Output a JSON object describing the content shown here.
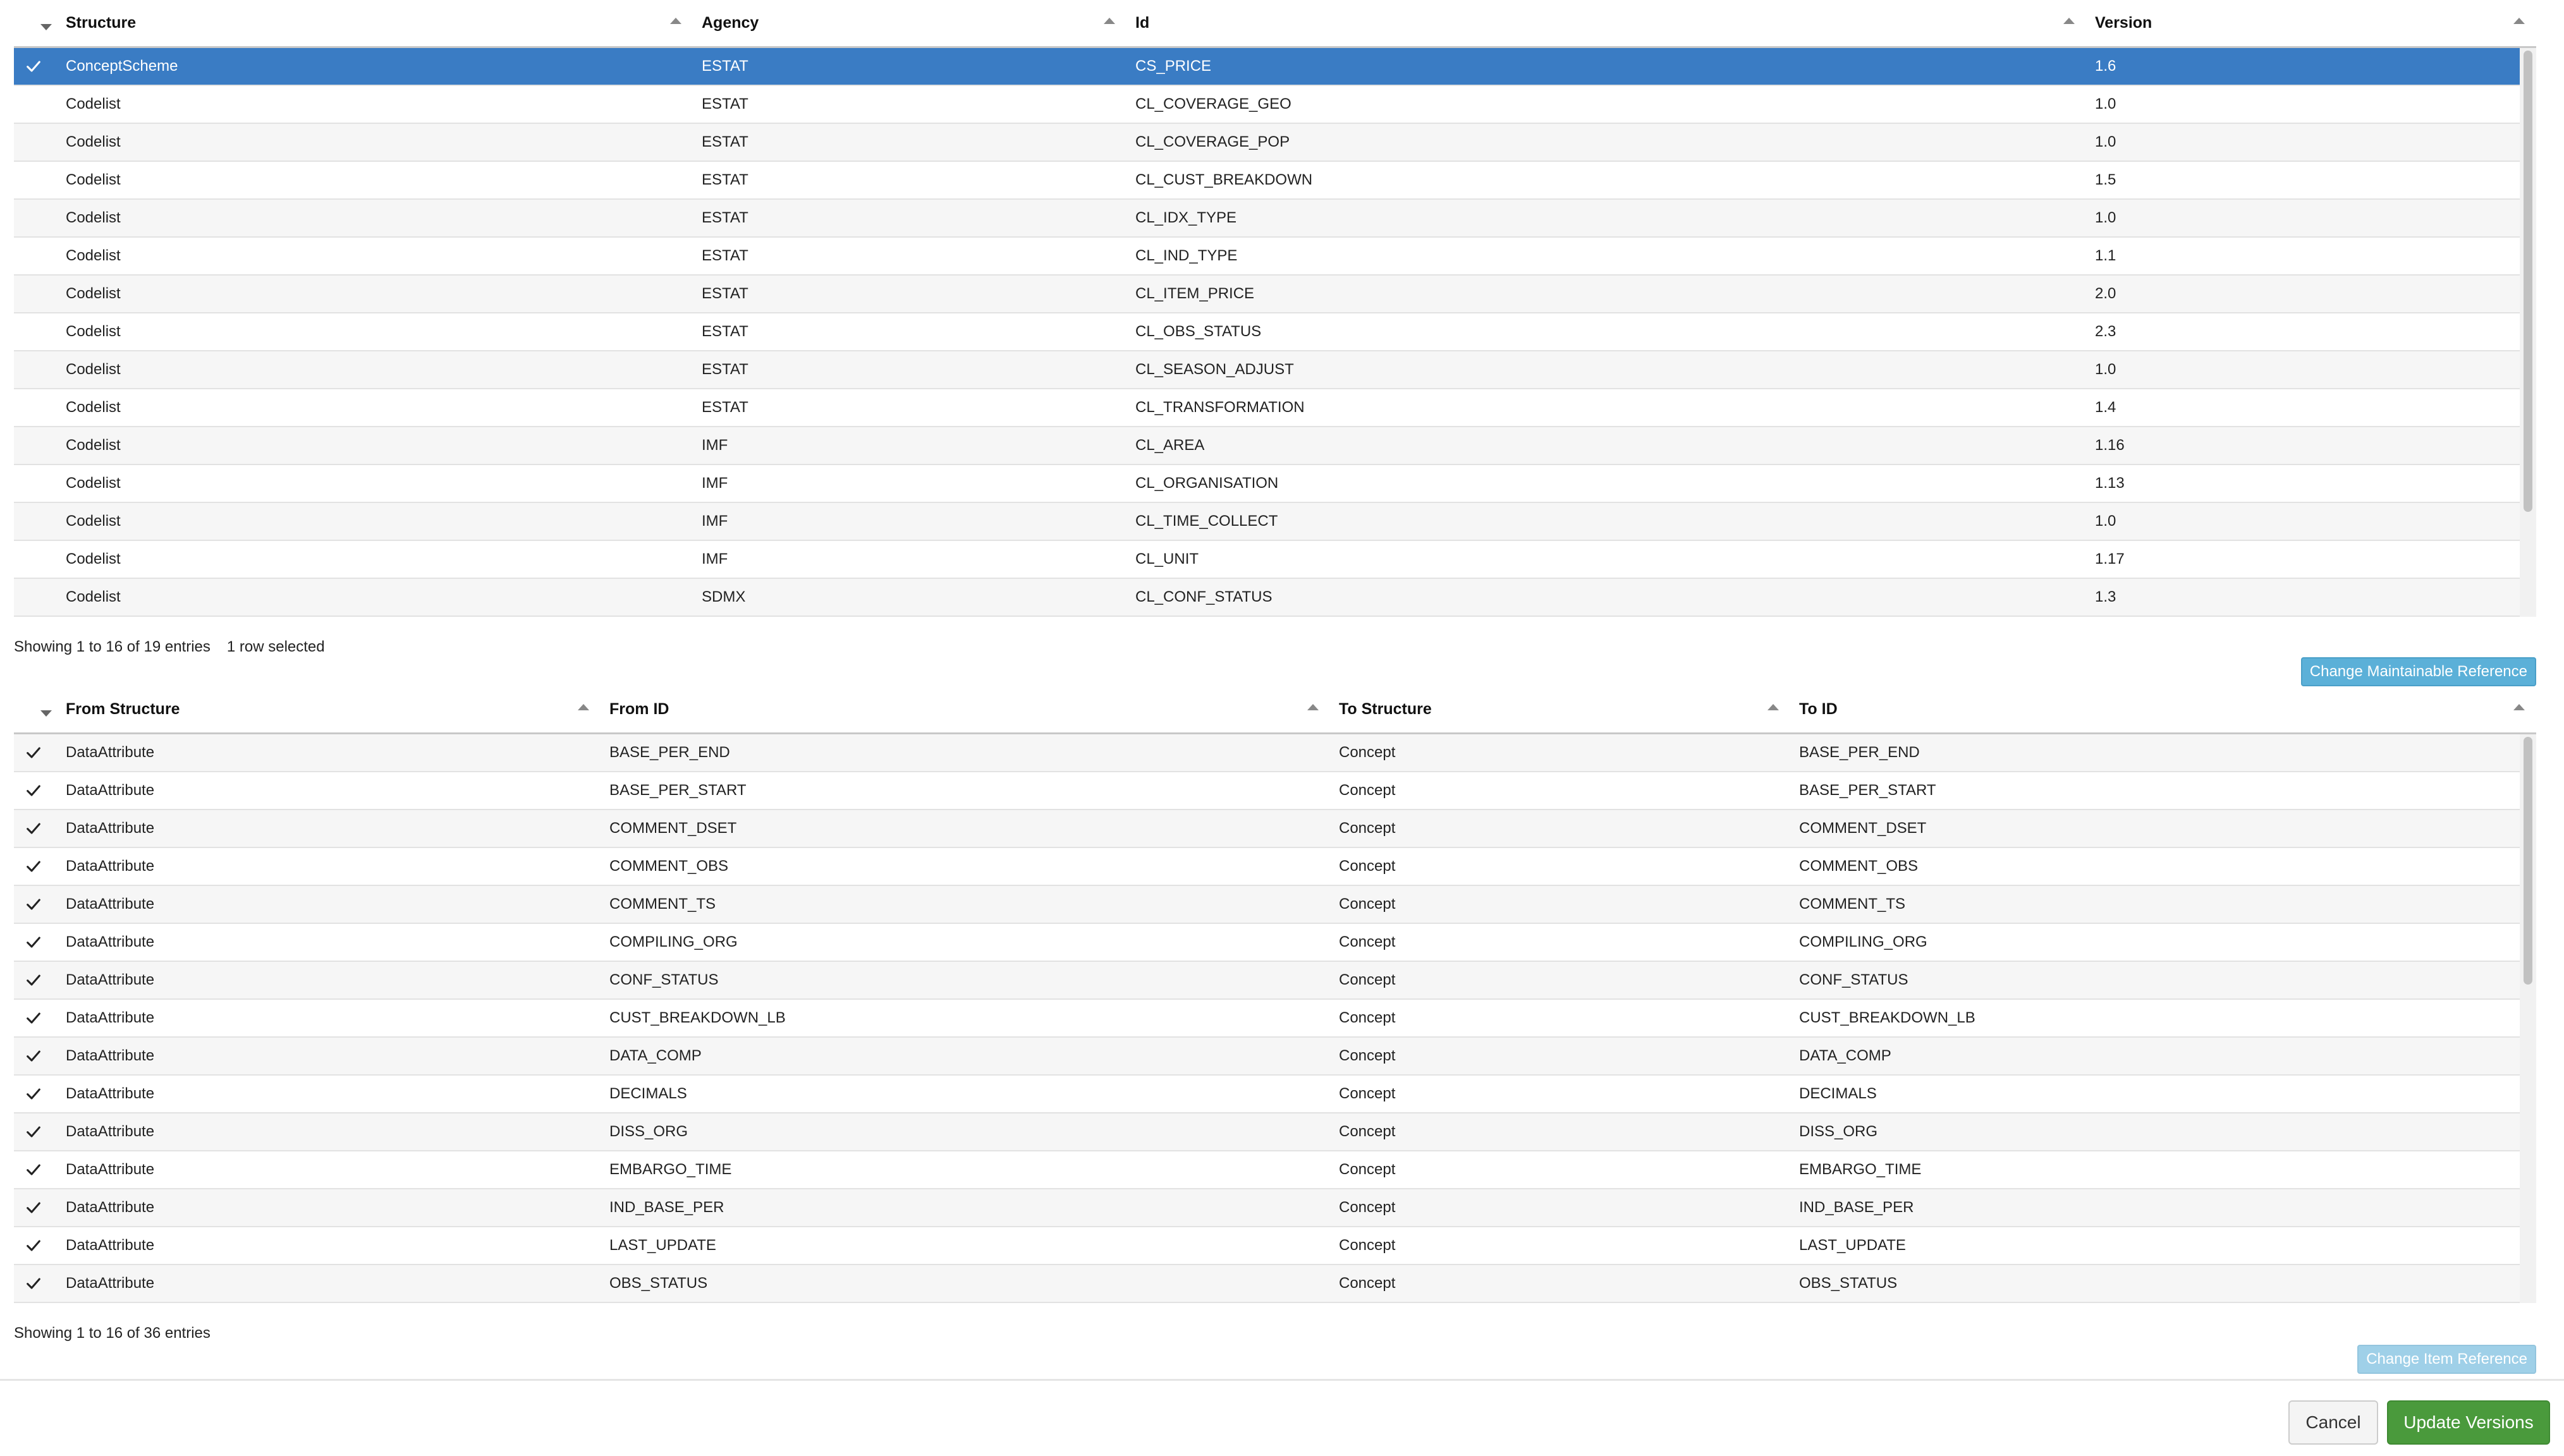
{
  "table1": {
    "columns": [
      "Structure",
      "Agency",
      "Id",
      "Version"
    ],
    "rows": [
      {
        "structure": "ConceptScheme",
        "agency": "ESTAT",
        "id": "CS_PRICE",
        "version": "1.6",
        "selected": true
      },
      {
        "structure": "Codelist",
        "agency": "ESTAT",
        "id": "CL_COVERAGE_GEO",
        "version": "1.0",
        "selected": false
      },
      {
        "structure": "Codelist",
        "agency": "ESTAT",
        "id": "CL_COVERAGE_POP",
        "version": "1.0",
        "selected": false
      },
      {
        "structure": "Codelist",
        "agency": "ESTAT",
        "id": "CL_CUST_BREAKDOWN",
        "version": "1.5",
        "selected": false
      },
      {
        "structure": "Codelist",
        "agency": "ESTAT",
        "id": "CL_IDX_TYPE",
        "version": "1.0",
        "selected": false
      },
      {
        "structure": "Codelist",
        "agency": "ESTAT",
        "id": "CL_IND_TYPE",
        "version": "1.1",
        "selected": false
      },
      {
        "structure": "Codelist",
        "agency": "ESTAT",
        "id": "CL_ITEM_PRICE",
        "version": "2.0",
        "selected": false
      },
      {
        "structure": "Codelist",
        "agency": "ESTAT",
        "id": "CL_OBS_STATUS",
        "version": "2.3",
        "selected": false
      },
      {
        "structure": "Codelist",
        "agency": "ESTAT",
        "id": "CL_SEASON_ADJUST",
        "version": "1.0",
        "selected": false
      },
      {
        "structure": "Codelist",
        "agency": "ESTAT",
        "id": "CL_TRANSFORMATION",
        "version": "1.4",
        "selected": false
      },
      {
        "structure": "Codelist",
        "agency": "IMF",
        "id": "CL_AREA",
        "version": "1.16",
        "selected": false
      },
      {
        "structure": "Codelist",
        "agency": "IMF",
        "id": "CL_ORGANISATION",
        "version": "1.13",
        "selected": false
      },
      {
        "structure": "Codelist",
        "agency": "IMF",
        "id": "CL_TIME_COLLECT",
        "version": "1.0",
        "selected": false
      },
      {
        "structure": "Codelist",
        "agency": "IMF",
        "id": "CL_UNIT",
        "version": "1.17",
        "selected": false
      },
      {
        "structure": "Codelist",
        "agency": "SDMX",
        "id": "CL_CONF_STATUS",
        "version": "1.3",
        "selected": false
      }
    ],
    "info": "Showing 1 to 16 of 19 entries",
    "selected_info": "1 row selected",
    "button": "Change Maintainable Reference"
  },
  "table2": {
    "columns": [
      "From Structure",
      "From ID",
      "To Structure",
      "To ID"
    ],
    "rows": [
      {
        "from_structure": "DataAttribute",
        "from_id": "BASE_PER_END",
        "to_structure": "Concept",
        "to_id": "BASE_PER_END",
        "checked": true
      },
      {
        "from_structure": "DataAttribute",
        "from_id": "BASE_PER_START",
        "to_structure": "Concept",
        "to_id": "BASE_PER_START",
        "checked": true
      },
      {
        "from_structure": "DataAttribute",
        "from_id": "COMMENT_DSET",
        "to_structure": "Concept",
        "to_id": "COMMENT_DSET",
        "checked": true
      },
      {
        "from_structure": "DataAttribute",
        "from_id": "COMMENT_OBS",
        "to_structure": "Concept",
        "to_id": "COMMENT_OBS",
        "checked": true
      },
      {
        "from_structure": "DataAttribute",
        "from_id": "COMMENT_TS",
        "to_structure": "Concept",
        "to_id": "COMMENT_TS",
        "checked": true
      },
      {
        "from_structure": "DataAttribute",
        "from_id": "COMPILING_ORG",
        "to_structure": "Concept",
        "to_id": "COMPILING_ORG",
        "checked": true
      },
      {
        "from_structure": "DataAttribute",
        "from_id": "CONF_STATUS",
        "to_structure": "Concept",
        "to_id": "CONF_STATUS",
        "checked": true
      },
      {
        "from_structure": "DataAttribute",
        "from_id": "CUST_BREAKDOWN_LB",
        "to_structure": "Concept",
        "to_id": "CUST_BREAKDOWN_LB",
        "checked": true
      },
      {
        "from_structure": "DataAttribute",
        "from_id": "DATA_COMP",
        "to_structure": "Concept",
        "to_id": "DATA_COMP",
        "checked": true
      },
      {
        "from_structure": "DataAttribute",
        "from_id": "DECIMALS",
        "to_structure": "Concept",
        "to_id": "DECIMALS",
        "checked": true
      },
      {
        "from_structure": "DataAttribute",
        "from_id": "DISS_ORG",
        "to_structure": "Concept",
        "to_id": "DISS_ORG",
        "checked": true
      },
      {
        "from_structure": "DataAttribute",
        "from_id": "EMBARGO_TIME",
        "to_structure": "Concept",
        "to_id": "EMBARGO_TIME",
        "checked": true
      },
      {
        "from_structure": "DataAttribute",
        "from_id": "IND_BASE_PER",
        "to_structure": "Concept",
        "to_id": "IND_BASE_PER",
        "checked": true
      },
      {
        "from_structure": "DataAttribute",
        "from_id": "LAST_UPDATE",
        "to_structure": "Concept",
        "to_id": "LAST_UPDATE",
        "checked": true
      },
      {
        "from_structure": "DataAttribute",
        "from_id": "OBS_STATUS",
        "to_structure": "Concept",
        "to_id": "OBS_STATUS",
        "checked": true
      }
    ],
    "info": "Showing 1 to 16 of 36 entries",
    "button": "Change Item Reference"
  },
  "footer": {
    "cancel_label": "Cancel",
    "update_label": "Update Versions"
  },
  "colors": {
    "selected_row": "#3a7cc4",
    "info_button": "#5bb0d8",
    "success_button": "#4a9a3c"
  }
}
